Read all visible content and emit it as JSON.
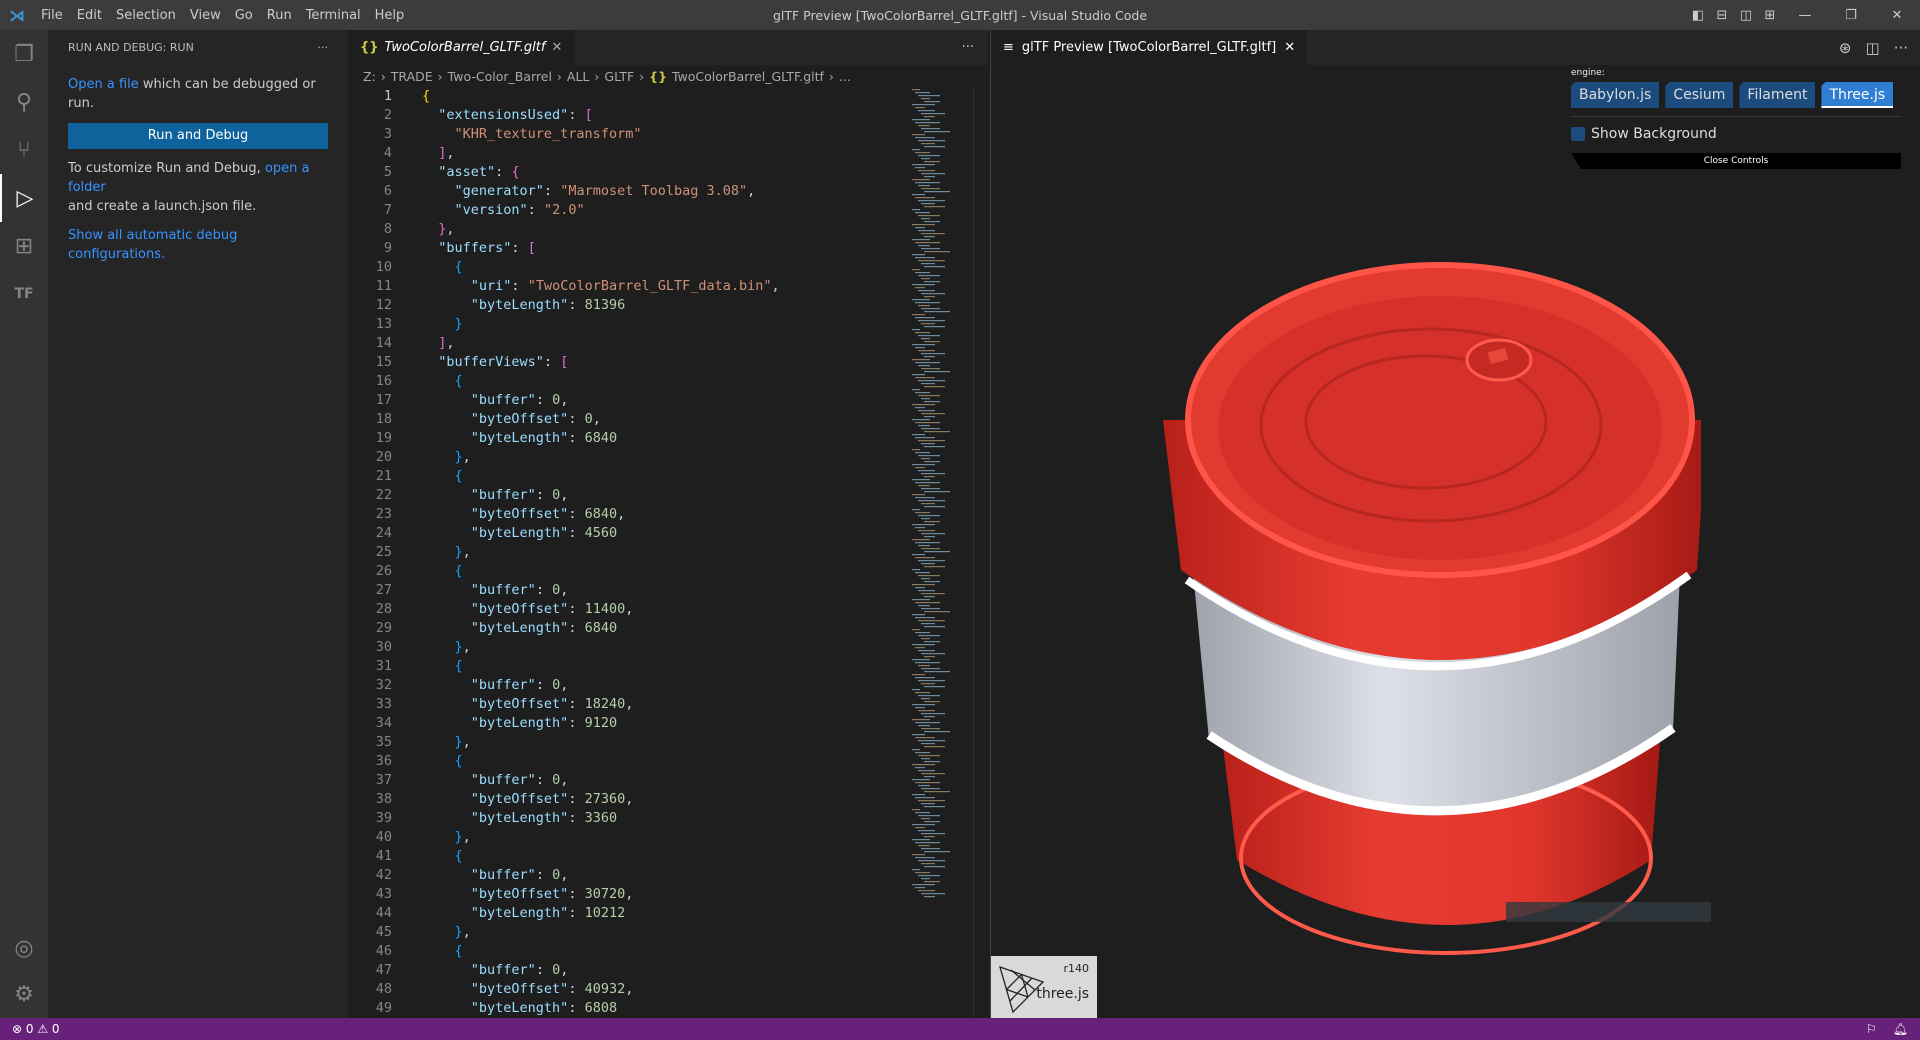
{
  "titlebar": {
    "menu": [
      "File",
      "Edit",
      "Selection",
      "View",
      "Go",
      "Run",
      "Terminal",
      "Help"
    ],
    "title": "glTF Preview [TwoColorBarrel_GLTF.gltf] - Visual Studio Code"
  },
  "sidebar": {
    "header": "RUN AND DEBUG: RUN",
    "open_file_link": "Open a file",
    "open_file_rest": " which can be debugged or run.",
    "run_button": "Run and Debug",
    "customize_text": "To customize Run and Debug, ",
    "open_folder_link": "open a folder",
    "customize_rest": "and create a launch.json file.",
    "show_all_link": "Show all automatic debug configurations."
  },
  "editor": {
    "tab_label": "TwoColorBarrel_GLTF.gltf",
    "breadcrumb": [
      "Z:",
      "TRADE",
      "Two-Color_Barrel",
      "ALL",
      "GLTF",
      "TwoColorBarrel_GLTF.gltf",
      "..."
    ],
    "lines": [
      [
        [
          "b1",
          "{"
        ]
      ],
      [
        [
          "p",
          "  "
        ],
        [
          "k",
          "\"extensionsUsed\""
        ],
        [
          "p",
          ": "
        ],
        [
          "b2",
          "["
        ]
      ],
      [
        [
          "p",
          "    "
        ],
        [
          "s",
          "\"KHR_texture_transform\""
        ]
      ],
      [
        [
          "p",
          "  "
        ],
        [
          "b2",
          "]"
        ],
        [
          "p",
          ","
        ]
      ],
      [
        [
          "p",
          "  "
        ],
        [
          "k",
          "\"asset\""
        ],
        [
          "p",
          ": "
        ],
        [
          "b2",
          "{"
        ]
      ],
      [
        [
          "p",
          "    "
        ],
        [
          "k",
          "\"generator\""
        ],
        [
          "p",
          ": "
        ],
        [
          "s",
          "\"Marmoset Toolbag 3.08\""
        ],
        [
          "p",
          ","
        ]
      ],
      [
        [
          "p",
          "    "
        ],
        [
          "k",
          "\"version\""
        ],
        [
          "p",
          ": "
        ],
        [
          "s",
          "\"2.0\""
        ]
      ],
      [
        [
          "p",
          "  "
        ],
        [
          "b2",
          "}"
        ],
        [
          "p",
          ","
        ]
      ],
      [
        [
          "p",
          "  "
        ],
        [
          "k",
          "\"buffers\""
        ],
        [
          "p",
          ": "
        ],
        [
          "b2",
          "["
        ]
      ],
      [
        [
          "p",
          "    "
        ],
        [
          "b3",
          "{"
        ]
      ],
      [
        [
          "p",
          "      "
        ],
        [
          "k",
          "\"uri\""
        ],
        [
          "p",
          ": "
        ],
        [
          "s",
          "\"TwoColorBarrel_GLTF_data.bin\""
        ],
        [
          "p",
          ","
        ]
      ],
      [
        [
          "p",
          "      "
        ],
        [
          "k",
          "\"byteLength\""
        ],
        [
          "p",
          ": "
        ],
        [
          "n",
          "81396"
        ]
      ],
      [
        [
          "p",
          "    "
        ],
        [
          "b3",
          "}"
        ]
      ],
      [
        [
          "p",
          "  "
        ],
        [
          "b2",
          "]"
        ],
        [
          "p",
          ","
        ]
      ],
      [
        [
          "p",
          "  "
        ],
        [
          "k",
          "\"bufferViews\""
        ],
        [
          "p",
          ": "
        ],
        [
          "b2",
          "["
        ]
      ],
      [
        [
          "p",
          "    "
        ],
        [
          "b3",
          "{"
        ]
      ],
      [
        [
          "p",
          "      "
        ],
        [
          "k",
          "\"buffer\""
        ],
        [
          "p",
          ": "
        ],
        [
          "n",
          "0"
        ],
        [
          "p",
          ","
        ]
      ],
      [
        [
          "p",
          "      "
        ],
        [
          "k",
          "\"byteOffset\""
        ],
        [
          "p",
          ": "
        ],
        [
          "n",
          "0"
        ],
        [
          "p",
          ","
        ]
      ],
      [
        [
          "p",
          "      "
        ],
        [
          "k",
          "\"byteLength\""
        ],
        [
          "p",
          ": "
        ],
        [
          "n",
          "6840"
        ]
      ],
      [
        [
          "p",
          "    "
        ],
        [
          "b3",
          "}"
        ],
        [
          "p",
          ","
        ]
      ],
      [
        [
          "p",
          "    "
        ],
        [
          "b3",
          "{"
        ]
      ],
      [
        [
          "p",
          "      "
        ],
        [
          "k",
          "\"buffer\""
        ],
        [
          "p",
          ": "
        ],
        [
          "n",
          "0"
        ],
        [
          "p",
          ","
        ]
      ],
      [
        [
          "p",
          "      "
        ],
        [
          "k",
          "\"byteOffset\""
        ],
        [
          "p",
          ": "
        ],
        [
          "n",
          "6840"
        ],
        [
          "p",
          ","
        ]
      ],
      [
        [
          "p",
          "      "
        ],
        [
          "k",
          "\"byteLength\""
        ],
        [
          "p",
          ": "
        ],
        [
          "n",
          "4560"
        ]
      ],
      [
        [
          "p",
          "    "
        ],
        [
          "b3",
          "}"
        ],
        [
          "p",
          ","
        ]
      ],
      [
        [
          "p",
          "    "
        ],
        [
          "b3",
          "{"
        ]
      ],
      [
        [
          "p",
          "      "
        ],
        [
          "k",
          "\"buffer\""
        ],
        [
          "p",
          ": "
        ],
        [
          "n",
          "0"
        ],
        [
          "p",
          ","
        ]
      ],
      [
        [
          "p",
          "      "
        ],
        [
          "k",
          "\"byteOffset\""
        ],
        [
          "p",
          ": "
        ],
        [
          "n",
          "11400"
        ],
        [
          "p",
          ","
        ]
      ],
      [
        [
          "p",
          "      "
        ],
        [
          "k",
          "\"byteLength\""
        ],
        [
          "p",
          ": "
        ],
        [
          "n",
          "6840"
        ]
      ],
      [
        [
          "p",
          "    "
        ],
        [
          "b3",
          "}"
        ],
        [
          "p",
          ","
        ]
      ],
      [
        [
          "p",
          "    "
        ],
        [
          "b3",
          "{"
        ]
      ],
      [
        [
          "p",
          "      "
        ],
        [
          "k",
          "\"buffer\""
        ],
        [
          "p",
          ": "
        ],
        [
          "n",
          "0"
        ],
        [
          "p",
          ","
        ]
      ],
      [
        [
          "p",
          "      "
        ],
        [
          "k",
          "\"byteOffset\""
        ],
        [
          "p",
          ": "
        ],
        [
          "n",
          "18240"
        ],
        [
          "p",
          ","
        ]
      ],
      [
        [
          "p",
          "      "
        ],
        [
          "k",
          "\"byteLength\""
        ],
        [
          "p",
          ": "
        ],
        [
          "n",
          "9120"
        ]
      ],
      [
        [
          "p",
          "    "
        ],
        [
          "b3",
          "}"
        ],
        [
          "p",
          ","
        ]
      ],
      [
        [
          "p",
          "    "
        ],
        [
          "b3",
          "{"
        ]
      ],
      [
        [
          "p",
          "      "
        ],
        [
          "k",
          "\"buffer\""
        ],
        [
          "p",
          ": "
        ],
        [
          "n",
          "0"
        ],
        [
          "p",
          ","
        ]
      ],
      [
        [
          "p",
          "      "
        ],
        [
          "k",
          "\"byteOffset\""
        ],
        [
          "p",
          ": "
        ],
        [
          "n",
          "27360"
        ],
        [
          "p",
          ","
        ]
      ],
      [
        [
          "p",
          "      "
        ],
        [
          "k",
          "\"byteLength\""
        ],
        [
          "p",
          ": "
        ],
        [
          "n",
          "3360"
        ]
      ],
      [
        [
          "p",
          "    "
        ],
        [
          "b3",
          "}"
        ],
        [
          "p",
          ","
        ]
      ],
      [
        [
          "p",
          "    "
        ],
        [
          "b3",
          "{"
        ]
      ],
      [
        [
          "p",
          "      "
        ],
        [
          "k",
          "\"buffer\""
        ],
        [
          "p",
          ": "
        ],
        [
          "n",
          "0"
        ],
        [
          "p",
          ","
        ]
      ],
      [
        [
          "p",
          "      "
        ],
        [
          "k",
          "\"byteOffset\""
        ],
        [
          "p",
          ": "
        ],
        [
          "n",
          "30720"
        ],
        [
          "p",
          ","
        ]
      ],
      [
        [
          "p",
          "      "
        ],
        [
          "k",
          "\"byteLength\""
        ],
        [
          "p",
          ": "
        ],
        [
          "n",
          "10212"
        ]
      ],
      [
        [
          "p",
          "    "
        ],
        [
          "b3",
          "}"
        ],
        [
          "p",
          ","
        ]
      ],
      [
        [
          "p",
          "    "
        ],
        [
          "b3",
          "{"
        ]
      ],
      [
        [
          "p",
          "      "
        ],
        [
          "k",
          "\"buffer\""
        ],
        [
          "p",
          ": "
        ],
        [
          "n",
          "0"
        ],
        [
          "p",
          ","
        ]
      ],
      [
        [
          "p",
          "      "
        ],
        [
          "k",
          "\"byteOffset\""
        ],
        [
          "p",
          ": "
        ],
        [
          "n",
          "40932"
        ],
        [
          "p",
          ","
        ]
      ],
      [
        [
          "p",
          "      "
        ],
        [
          "k",
          "\"byteLength\""
        ],
        [
          "p",
          ": "
        ],
        [
          "n",
          "6808"
        ]
      ]
    ]
  },
  "preview": {
    "tab_label": "glTF Preview [TwoColorBarrel_GLTF.gltf]",
    "engine_label": "engine:",
    "engines": [
      {
        "label": "Babylon.js",
        "active": false
      },
      {
        "label": "Cesium",
        "active": false
      },
      {
        "label": "Filament",
        "active": false
      },
      {
        "label": "Three.js",
        "active": true
      }
    ],
    "show_background": "Show Background",
    "close_controls": "Close Controls",
    "logo_version": "r140",
    "logo_name": "three.js"
  },
  "status": {
    "errors": "0",
    "warnings": "0"
  },
  "colors": {
    "accent": "#0e639c",
    "status_bar": "#68217a",
    "barrel_red": "#e0362c",
    "barrel_white": "#d8dbe3"
  }
}
